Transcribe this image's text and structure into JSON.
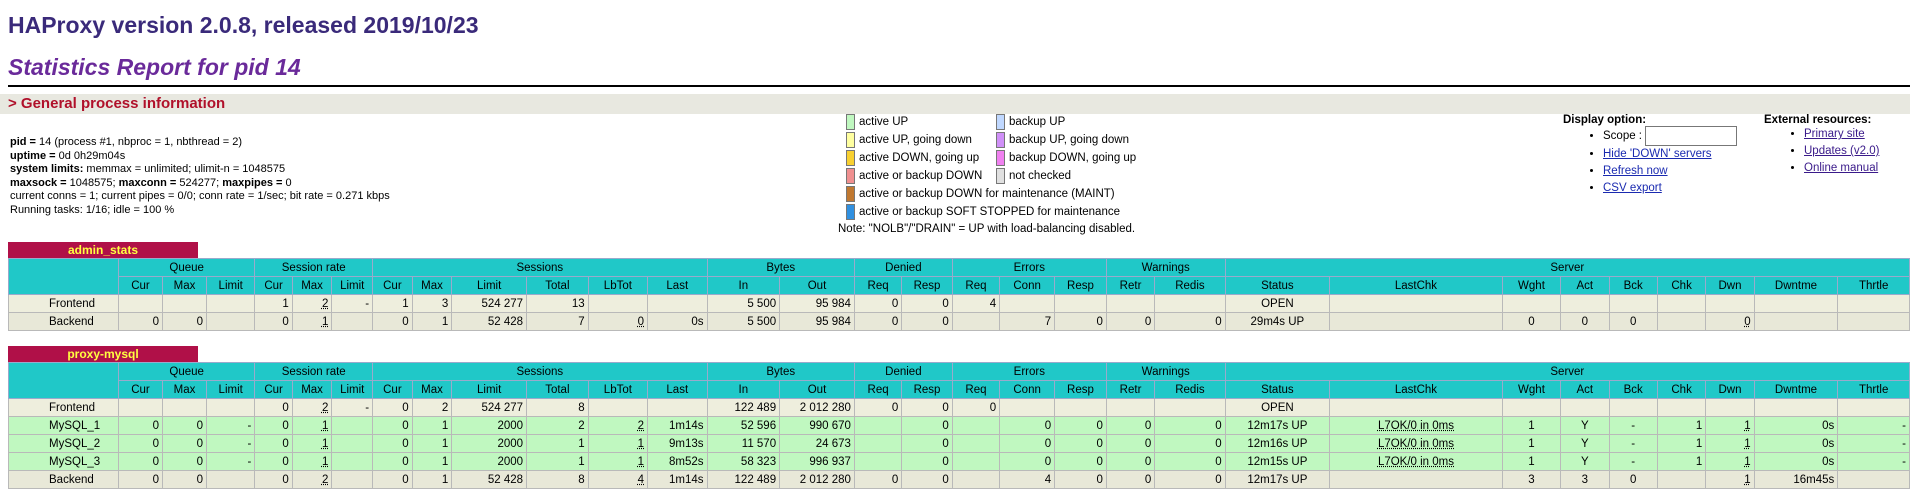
{
  "header": {
    "version_title": "HAProxy version 2.0.8, released 2019/10/23",
    "report_title": "Statistics Report for pid 14",
    "section_title": "> General process information"
  },
  "process_info": {
    "pid_label": "pid =",
    "pid_text": " 14 (process #1, nbproc = 1, nbthread = 2)",
    "uptime_label": "uptime =",
    "uptime_text": " 0d 0h29m04s",
    "limits_label": "system limits:",
    "limits_text": " memmax = unlimited; ulimit-n = 1048575",
    "maxsock_label": "maxsock =",
    "maxsock_text": " 1048575; ",
    "maxconn_label": "maxconn =",
    "maxconn_text": " 524277; ",
    "maxpipes_label": "maxpipes =",
    "maxpipes_text": " 0",
    "conns_text": "current conns = 1; current pipes = 0/0; conn rate = 1/sec; bit rate = 0.271 kbps",
    "tasks_text": "Running tasks: 1/16; idle = 100 %"
  },
  "legend": {
    "left": [
      {
        "color": "#c0f8c0",
        "label": "active UP"
      },
      {
        "color": "#ffffa0",
        "label": "active UP, going down"
      },
      {
        "color": "#f8d030",
        "label": "active DOWN, going up"
      },
      {
        "color": "#f09090",
        "label": "active or backup DOWN"
      },
      {
        "color": "#c07830",
        "label": "active or backup DOWN for maintenance (MAINT)"
      },
      {
        "color": "#3090e0",
        "label": "active or backup SOFT STOPPED for maintenance"
      }
    ],
    "right": [
      {
        "color": "#c0d8ff",
        "label": "backup UP"
      },
      {
        "color": "#d090f8",
        "label": "backup UP, going down"
      },
      {
        "color": "#f080f0",
        "label": "backup DOWN, going up"
      },
      {
        "color": "#e0e0e0",
        "label": "not checked"
      }
    ],
    "note": "Note: \"NOLB\"/\"DRAIN\" = UP with load-balancing disabled."
  },
  "display_options": {
    "title": "Display option:",
    "scope_label": "Scope :",
    "scope_value": "",
    "hide_down": "Hide 'DOWN' servers",
    "refresh": "Refresh now",
    "csv": "CSV export"
  },
  "external": {
    "title": "External resources:",
    "primary": "Primary site",
    "updates": "Updates (v2.0)",
    "manual": "Online manual"
  },
  "table_headers": {
    "queue": "Queue",
    "session_rate": "Session rate",
    "sessions": "Sessions",
    "bytes": "Bytes",
    "denied": "Denied",
    "errors": "Errors",
    "warnings": "Warnings",
    "server": "Server",
    "cur": "Cur",
    "max": "Max",
    "limit": "Limit",
    "total": "Total",
    "lbtot": "LbTot",
    "last": "Last",
    "in": "In",
    "out": "Out",
    "req": "Req",
    "resp": "Resp",
    "conn": "Conn",
    "retr": "Retr",
    "redis": "Redis",
    "status": "Status",
    "lastchk": "LastChk",
    "wght": "Wght",
    "act": "Act",
    "bck": "Bck",
    "chk": "Chk",
    "dwn": "Dwn",
    "dwntme": "Dwntme",
    "thrtle": "Thrtle"
  },
  "proxies": [
    {
      "name": "admin_stats",
      "rows": [
        {
          "type": "front",
          "cells": [
            "Frontend",
            "",
            "",
            "",
            "1",
            "2",
            "-",
            "1",
            "3",
            "524 277",
            "13",
            "",
            "",
            "5 500",
            "95 984",
            "0",
            "0",
            "4",
            "",
            "",
            "",
            "",
            "OPEN",
            "",
            "",
            "",
            "",
            "",
            "",
            "",
            ""
          ]
        },
        {
          "type": "back",
          "cells": [
            "Backend",
            "0",
            "0",
            "",
            "0",
            "1",
            "",
            "0",
            "1",
            "52 428",
            "7",
            "0",
            "0s",
            "5 500",
            "95 984",
            "0",
            "0",
            "",
            "7",
            "0",
            "0",
            "0",
            "29m4s UP",
            "",
            "0",
            "0",
            "0",
            "",
            "0",
            "",
            ""
          ]
        }
      ]
    },
    {
      "name": "proxy-mysql",
      "rows": [
        {
          "type": "front",
          "cells": [
            "Frontend",
            "",
            "",
            "",
            "0",
            "2",
            "-",
            "0",
            "2",
            "524 277",
            "8",
            "",
            "",
            "122 489",
            "2 012 280",
            "0",
            "0",
            "0",
            "",
            "",
            "",
            "",
            "OPEN",
            "",
            "",
            "",
            "",
            "",
            "",
            "",
            ""
          ]
        },
        {
          "type": "up",
          "cells": [
            "MySQL_1",
            "0",
            "0",
            "-",
            "0",
            "1",
            "",
            "0",
            "1",
            "2000",
            "2",
            "2",
            "1m14s",
            "52 596",
            "990 670",
            "",
            "0",
            "",
            "0",
            "0",
            "0",
            "0",
            "12m17s UP",
            "L7OK/0 in 0ms",
            "1",
            "Y",
            "-",
            "1",
            "1",
            "0s",
            "-"
          ]
        },
        {
          "type": "up",
          "cells": [
            "MySQL_2",
            "0",
            "0",
            "-",
            "0",
            "1",
            "",
            "0",
            "1",
            "2000",
            "1",
            "1",
            "9m13s",
            "11 570",
            "24 673",
            "",
            "0",
            "",
            "0",
            "0",
            "0",
            "0",
            "12m16s UP",
            "L7OK/0 in 0ms",
            "1",
            "Y",
            "-",
            "1",
            "1",
            "0s",
            "-"
          ]
        },
        {
          "type": "up",
          "cells": [
            "MySQL_3",
            "0",
            "0",
            "-",
            "0",
            "1",
            "",
            "0",
            "1",
            "2000",
            "1",
            "1",
            "8m52s",
            "58 323",
            "996 937",
            "",
            "0",
            "",
            "0",
            "0",
            "0",
            "0",
            "12m15s UP",
            "L7OK/0 in 0ms",
            "1",
            "Y",
            "-",
            "1",
            "1",
            "0s",
            "-"
          ]
        },
        {
          "type": "back",
          "cells": [
            "Backend",
            "0",
            "0",
            "",
            "0",
            "2",
            "",
            "0",
            "1",
            "52 428",
            "8",
            "4",
            "1m14s",
            "122 489",
            "2 012 280",
            "0",
            "0",
            "",
            "4",
            "0",
            "0",
            "0",
            "12m17s UP",
            "",
            "3",
            "3",
            "0",
            "",
            "1",
            "16m45s",
            ""
          ]
        }
      ]
    }
  ]
}
